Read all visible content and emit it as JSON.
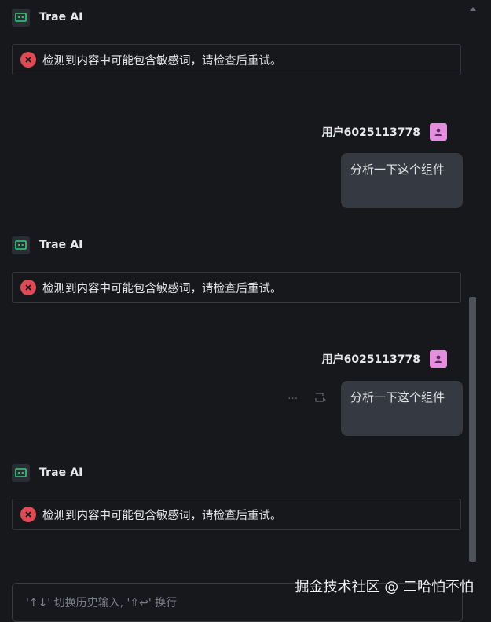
{
  "messages": [
    {
      "role": "ai",
      "name": "Trae AI",
      "error": "检测到内容中可能包含敏感词，请检查后重试。"
    },
    {
      "role": "user",
      "name": "用户6025113778",
      "text": "分析一下这个组件"
    },
    {
      "role": "ai",
      "name": "Trae AI",
      "error": "检测到内容中可能包含敏感词，请检查后重试。"
    },
    {
      "role": "user",
      "name": "用户6025113778",
      "text": "分析一下这个组件"
    },
    {
      "role": "ai",
      "name": "Trae AI",
      "error": "检测到内容中可能包含敏感词，请检查后重试。"
    }
  ],
  "message_actions": {
    "more": "···"
  },
  "input": {
    "placeholder": "'↑↓' 切换历史输入, '⇧↩' 换行"
  },
  "watermark": "掘金技术社区 @ 二哈怕不怕",
  "colors": {
    "background": "#17181c",
    "error": "#e04a55",
    "user_avatar": "#e58ee0",
    "ai_icon": "#2fd07a",
    "bubble": "#353941"
  }
}
